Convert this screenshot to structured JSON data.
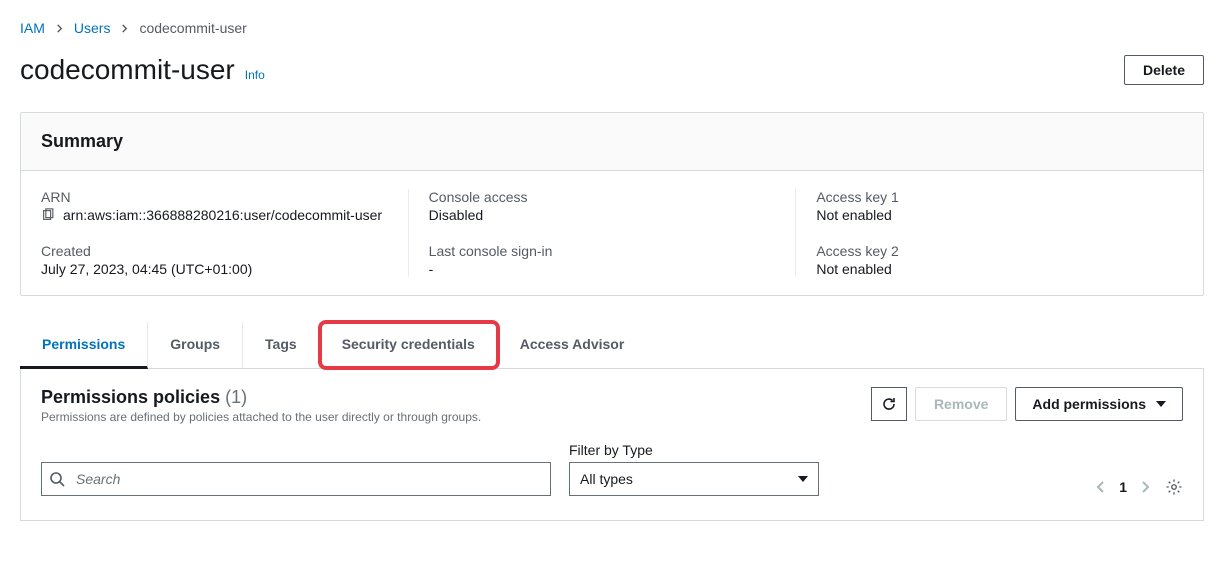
{
  "breadcrumb": {
    "root": "IAM",
    "users": "Users",
    "current": "codecommit-user"
  },
  "header": {
    "title": "codecommit-user",
    "info": "Info",
    "delete": "Delete"
  },
  "summary": {
    "title": "Summary",
    "arn_label": "ARN",
    "arn_value": "arn:aws:iam::366888280216:user/codecommit-user",
    "created_label": "Created",
    "created_value": "July 27, 2023, 04:45 (UTC+01:00)",
    "console_access_label": "Console access",
    "console_access_value": "Disabled",
    "last_signin_label": "Last console sign-in",
    "last_signin_value": "-",
    "key1_label": "Access key 1",
    "key1_value": "Not enabled",
    "key2_label": "Access key 2",
    "key2_value": "Not enabled"
  },
  "tabs": {
    "permissions": "Permissions",
    "groups": "Groups",
    "tags": "Tags",
    "security": "Security credentials",
    "advisor": "Access Advisor"
  },
  "permissions": {
    "title": "Permissions policies",
    "count": "(1)",
    "desc": "Permissions are defined by policies attached to the user directly or through groups.",
    "remove": "Remove",
    "add": "Add permissions",
    "search_placeholder": "Search",
    "filter_label": "Filter by Type",
    "filter_selected": "All types",
    "page": "1"
  }
}
